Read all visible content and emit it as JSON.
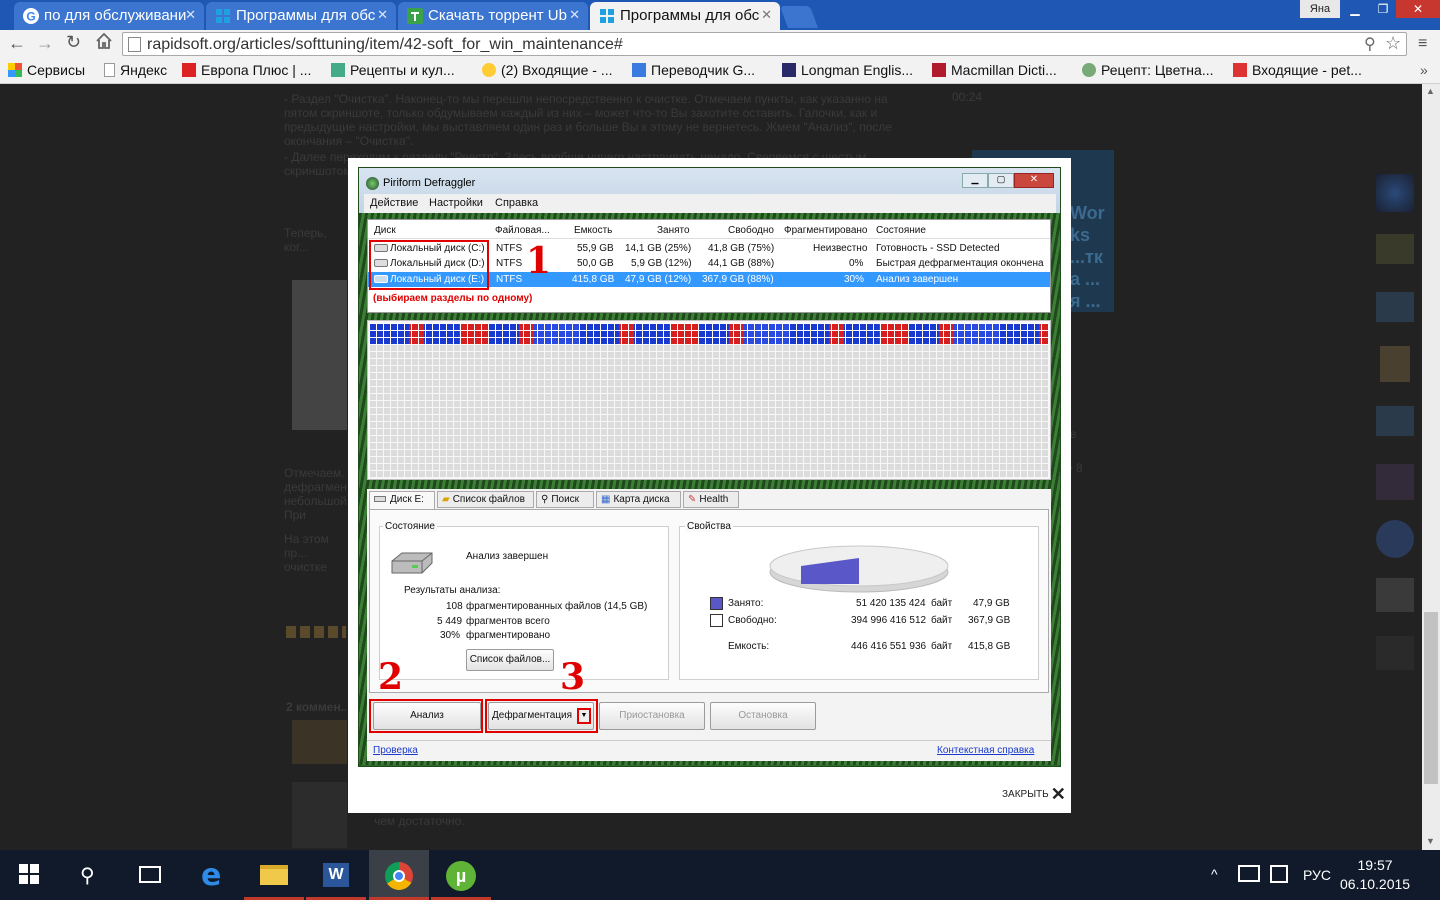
{
  "tabs": [
    {
      "label": "по для обслуживани",
      "icon": "google-icon"
    },
    {
      "label": "Программы для обс",
      "icon": "windows-icon"
    },
    {
      "label": "Скачать торрент Ub",
      "icon": "torrent-icon"
    },
    {
      "label": "Программы для обс",
      "icon": "windows-icon",
      "active": true
    }
  ],
  "user_badge": "Яна",
  "address": {
    "url": "rapidsoft.org/articles/softtuning/item/42-soft_for_win_maintenance#"
  },
  "bookmarks": [
    "Сервисы",
    "Яндекс",
    "Европа Плюс | ...",
    "Рецепты и кул...",
    "(2) Входящие - ...",
    "Переводчик G...",
    "Longman Englis...",
    "Macmillan Dicti...",
    "Рецепт: Цветна...",
    "Входящие - pet..."
  ],
  "page": {
    "para1": "- Раздел \"Очистка\". Наконец-то мы перешли непосредственно к очистке. Отмечаем пункты, как указанно на пятом скриншоте, только обдумываем каждый из них – может что-то Вы захотите оставить. Галочки, как и предыдущие настройки, мы выставляем один раз и больше Вы к этому не вернетесь. Жмем \"Анализ\", после окончания – \"Очистка\".",
    "para2": "- Далее переходим к разделу \"Реестр\". Здесь вообще ничего настраивать ненадо. Сверяемся с шестым скриншотом... \"Исправить\"... процедуру...",
    "left_frag1": "Теперь, ког... файлы на д...",
    "left_frag2": "Отмечаем... дефрагмен... небольшой... При испол...",
    "left_frag3": "На этом пр... очистке ра... зависимост...",
    "comments": "2 коммен...",
    "footer_text": "чем достаточно.",
    "sidebar_time": "00:24",
    "sidebar_frag1": "в",
    "sidebar_frag2": "е 8",
    "side_ad": "Works ...тка ...я ...ия ...nk"
  },
  "modal": {
    "close_label": "ЗАКРЫТЬ"
  },
  "defraggler": {
    "title": "Piriform Defraggler",
    "menu": [
      "Действие",
      "Настройки",
      "Справка"
    ],
    "columns": [
      "Диск",
      "Файловая...",
      "Емкость",
      "Занято",
      "Свободно",
      "Фрагментировано",
      "Состояние"
    ],
    "drives": [
      {
        "name": "Локальный диск (C:)",
        "fs": "NTFS",
        "capacity": "55,9 GB",
        "used": "14,1 GB (25%)",
        "free": "41,8 GB (75%)",
        "frag": "Неизвестно",
        "state": "Готовность - SSD Detected"
      },
      {
        "name": "Локальный диск (D:)",
        "fs": "NTFS",
        "capacity": "50,0 GB",
        "used": "5,9 GB (12%)",
        "free": "44,1 GB (88%)",
        "frag": "0%",
        "state": "Быстрая дефрагментация окончена"
      },
      {
        "name": "Локальный диск (E:)",
        "fs": "NTFS",
        "capacity": "415,8 GB",
        "used": "47,9 GB (12%)",
        "free": "367,9 GB (88%)",
        "frag": "30%",
        "state": "Анализ завершен",
        "selected": true
      }
    ],
    "annotation_hint": "(выбираем разделы по одному)",
    "marker1": "1",
    "marker2": "2",
    "marker3": "3",
    "tabs": [
      "Диск E:",
      "Список файлов",
      "Поиск",
      "Карта диска",
      "Health"
    ],
    "status": {
      "heading": "Состояние",
      "text": "Анализ завершен",
      "results_title": "Результаты анализа:",
      "results": [
        {
          "n": "108",
          "t": "фрагментированных файлов (14,5 GB)"
        },
        {
          "n": "5 449",
          "t": "фрагментов всего"
        },
        {
          "n": "30%",
          "t": "фрагментировано"
        }
      ],
      "file_list_button": "Список файлов..."
    },
    "props": {
      "heading": "Свойства",
      "used_label": "Занято:",
      "used_bytes": "51 420 135 424",
      "used_unit": "байт",
      "used_gb": "47,9 GB",
      "free_label": "Свободно:",
      "free_bytes": "394 996 416 512",
      "free_unit": "байт",
      "free_gb": "367,9 GB",
      "cap_label": "Емкость:",
      "cap_bytes": "446 416 551 936",
      "cap_unit": "байт",
      "cap_gb": "415,8 GB",
      "used_color": "#5a57c8",
      "used_fraction": 0.12
    },
    "buttons": {
      "analyze": "Анализ",
      "defrag": "Дефрагментация",
      "pause": "Приостановка",
      "stop": "Остановка"
    },
    "footer": {
      "check": "Проверка",
      "help": "Контекстная справка"
    }
  },
  "taskbar": {
    "lang": "РУС",
    "time": "19:57",
    "date": "06.10.2015"
  }
}
